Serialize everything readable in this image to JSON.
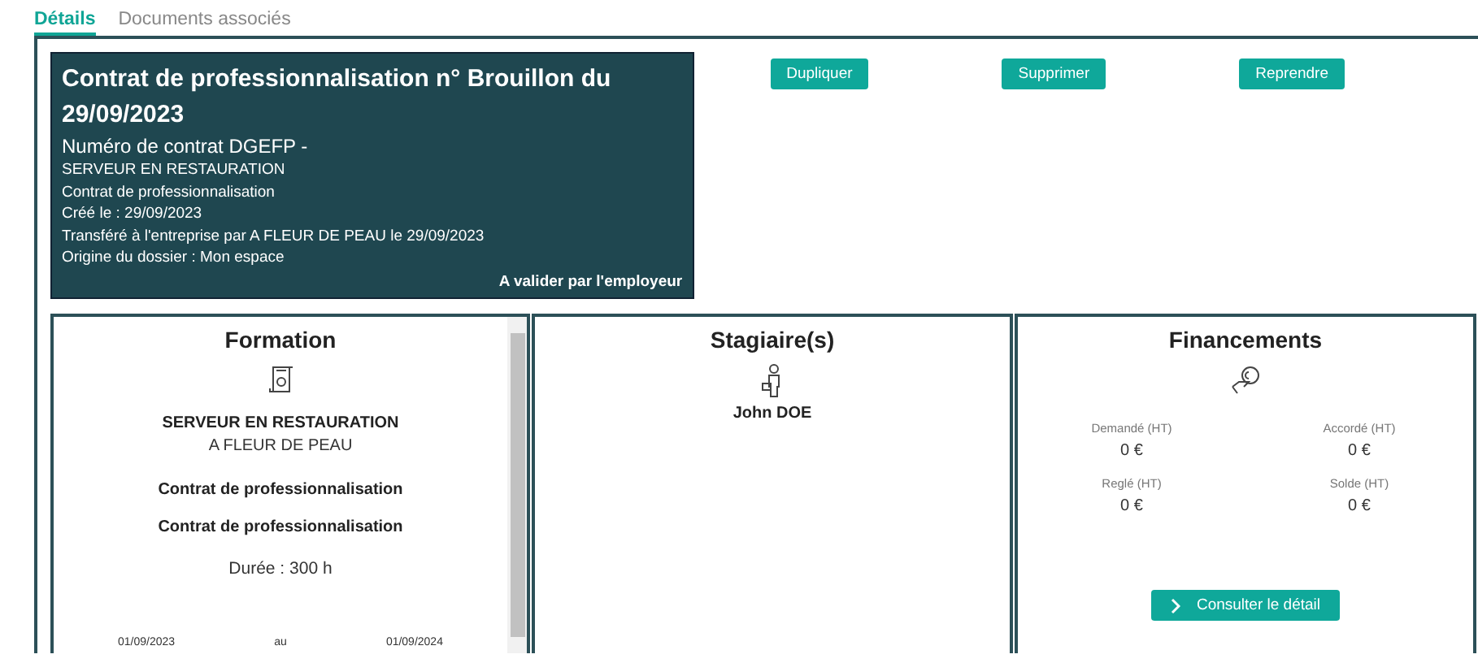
{
  "tabs": [
    {
      "label": "Détails",
      "selected": true
    },
    {
      "label": "Documents associés",
      "selected": false
    }
  ],
  "header": {
    "title": "Contrat de professionnalisation n° Brouillon du 29/09/2023",
    "subtitle": "Numéro de contrat DGEFP -",
    "lines": [
      "SERVEUR EN RESTAURATION",
      "Contrat de professionnalisation",
      "Créé le : 29/09/2023",
      "Transféré à l'entreprise par A FLEUR DE PEAU le 29/09/2023",
      "Origine du dossier : Mon espace"
    ],
    "status": "A valider par l'employeur"
  },
  "actions": [
    "Dupliquer",
    "Supprimer",
    "Reprendre"
  ],
  "formation": {
    "title": "Formation",
    "name": "SERVEUR EN RESTAURATION",
    "organisme": "A FLEUR DE PEAU",
    "contract_lines": [
      "Contrat de professionnalisation",
      "Contrat de professionnalisation"
    ],
    "duration": "Durée :  300  h",
    "start": "01/09/2023",
    "separator": "au",
    "end": "01/09/2024"
  },
  "stagiaires": {
    "title": "Stagiaire(s)",
    "people": [
      "John DOE"
    ]
  },
  "financements": {
    "title": "Financements",
    "amounts": [
      {
        "label": "Demandé (HT)",
        "value": "0 €"
      },
      {
        "label": "Accordé (HT)",
        "value": "0 €"
      },
      {
        "label": "Reglé (HT)",
        "value": "0 €"
      },
      {
        "label": "Solde (HT)",
        "value": "0 €"
      }
    ],
    "button": "Consulter le détail"
  }
}
